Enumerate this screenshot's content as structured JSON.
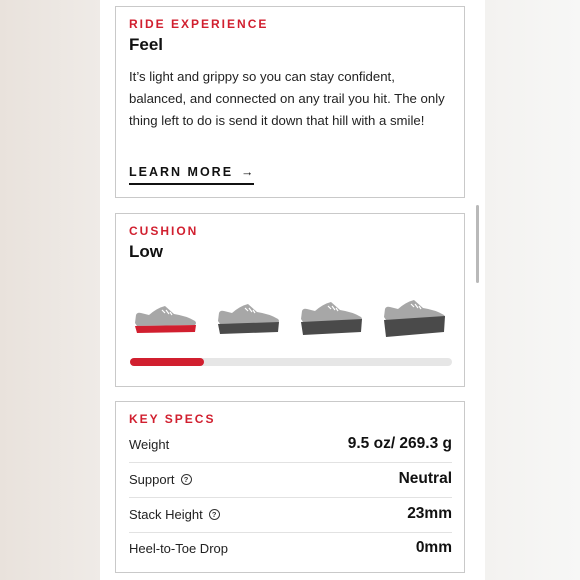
{
  "ride_experience": {
    "eyebrow": "RIDE EXPERIENCE",
    "title": "Feel",
    "description": "It’s light and grippy so you can stay confident, balanced, and connected on any trail you hit. The only thing left to do is send it down that hill with a smile!",
    "learn_more": "LEARN MORE",
    "learn_more_arrow": "→"
  },
  "cushion": {
    "eyebrow": "CUSHION",
    "title": "Low",
    "levels": [
      "low",
      "medium",
      "high",
      "max"
    ],
    "selected_level": "low",
    "progress_fraction": 0.23,
    "colors": {
      "active_sole": "#d11f2f",
      "inactive_sole": "#4a4a4a",
      "upper": "#a7a7a7",
      "track": "#e6e6e6",
      "fill": "#d11f2f"
    }
  },
  "key_specs": {
    "eyebrow": "KEY SPECS",
    "rows": [
      {
        "label": "Weight",
        "value": "9.5 oz/ 269.3 g",
        "help": false
      },
      {
        "label": "Support",
        "value": "Neutral",
        "help": true
      },
      {
        "label": "Stack Height",
        "value": "23mm",
        "help": true
      },
      {
        "label": "Heel-to-Toe Drop",
        "value": "0mm",
        "help": false
      }
    ]
  },
  "help_icon": "question-circle-icon"
}
